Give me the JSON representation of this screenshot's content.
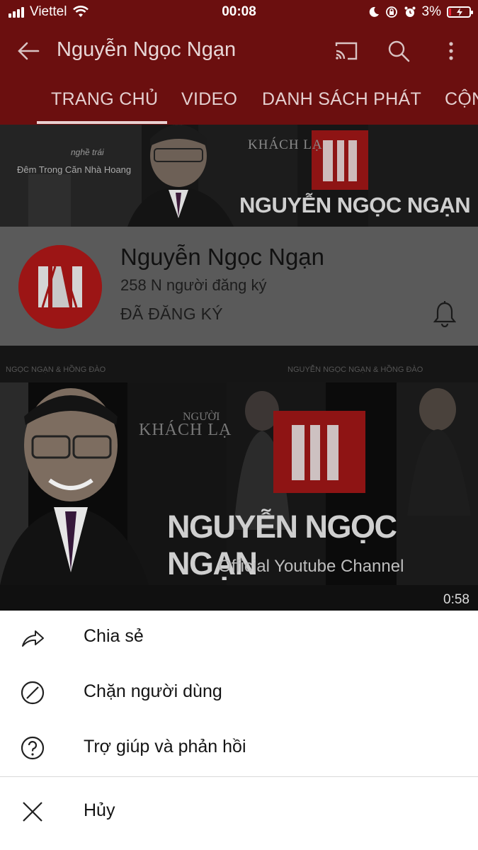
{
  "status_bar": {
    "carrier": "Viettel",
    "time": "00:08",
    "battery": "3%",
    "battery_level": 0.03
  },
  "header": {
    "title": "Nguyễn Ngọc Ngạn"
  },
  "tabs": [
    {
      "label": "TRANG CHỦ",
      "active": true
    },
    {
      "label": "VIDEO"
    },
    {
      "label": "DANH SÁCH PHÁT"
    },
    {
      "label": "CỘN"
    }
  ],
  "banner": {
    "name_text": "NGUYỄN NGỌC NGẠN",
    "small_text_1": "Đêm Trong Căn Nhà Hoang",
    "small_text_2": "KHÁCH LẠ",
    "small_text_3": "nghề trái"
  },
  "channel": {
    "name": "Nguyễn Ngọc Ngạn",
    "subscribers": "258 N người đăng ký",
    "subscribed_label": "ĐÃ ĐĂNG KÝ"
  },
  "video": {
    "top_left_text": "NGỌC NGẠN & HỒNG ĐÀO",
    "top_mid_text": "NGUYỄN NGỌC NGẠN & HỒNG ĐÀO",
    "name_text": "NGUYỄN NGỌC NGẠN",
    "subtitle": "Official Youtube Channel",
    "khach_la": "KHÁCH LẠ",
    "nguoi": "NGƯỜI",
    "duration": "0:58"
  },
  "menu": {
    "share": "Chia sẻ",
    "block": "Chặn người dùng",
    "help": "Trợ giúp và phản hồi",
    "cancel": "Hủy"
  },
  "colors": {
    "header_bg": "#6b0f0f",
    "brand_red": "#c01c1c",
    "sheet_bg": "#ffffff"
  }
}
